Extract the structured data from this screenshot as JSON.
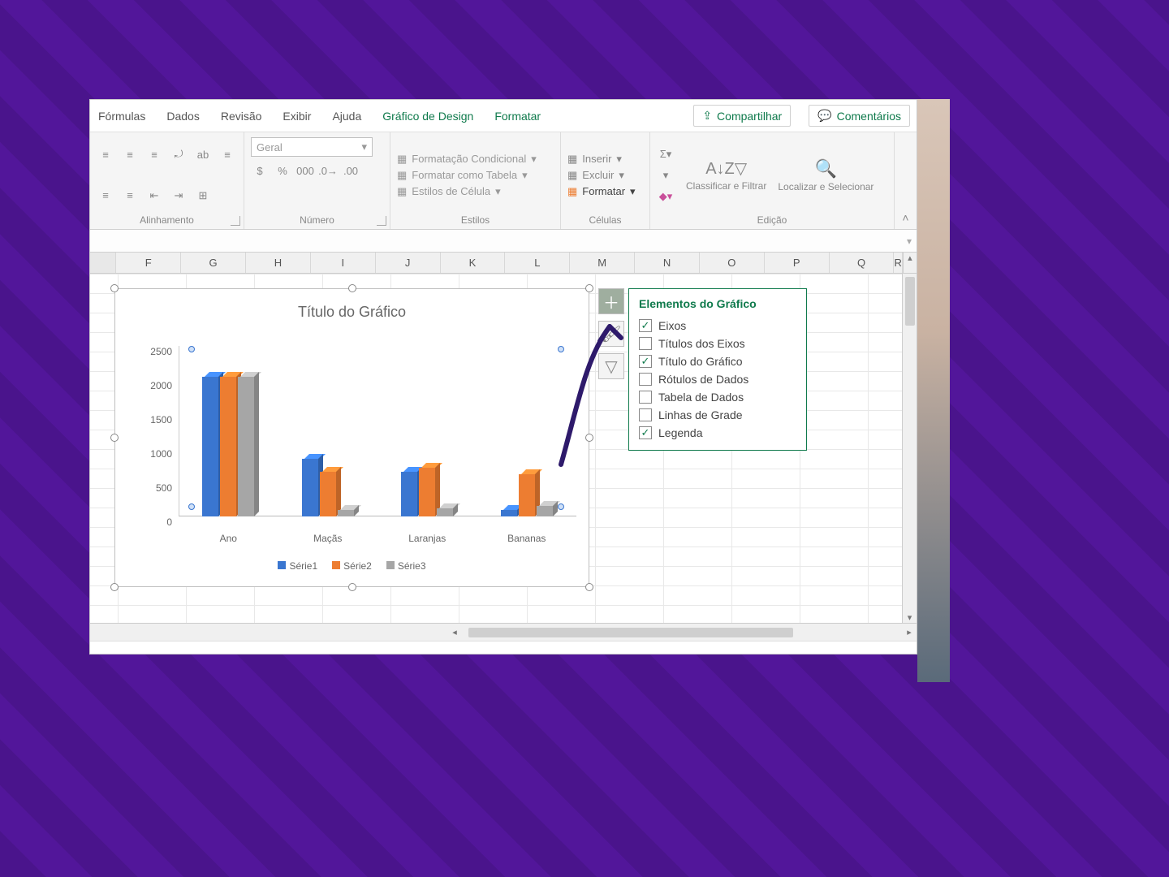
{
  "ribbon": {
    "tabs": [
      "Fórmulas",
      "Dados",
      "Revisão",
      "Exibir",
      "Ajuda"
    ],
    "context_tabs": [
      "Gráfico de Design",
      "Formatar"
    ],
    "share": "Compartilhar",
    "comments": "Comentários",
    "groups": {
      "alignment": "Alinhamento",
      "number": "Número",
      "number_format": "Geral",
      "styles": "Estilos",
      "cells": "Células",
      "editing": "Edição"
    },
    "styles_items": [
      "Formatação Condicional",
      "Formatar como Tabela",
      "Estilos de Célula"
    ],
    "cells_items": [
      "Inserir",
      "Excluir",
      "Formatar"
    ],
    "editing_items": {
      "sort": "Classificar e Filtrar",
      "find": "Localizar e Selecionar"
    }
  },
  "columns": [
    "F",
    "G",
    "H",
    "I",
    "J",
    "K",
    "L",
    "M",
    "N",
    "O",
    "P",
    "Q",
    "R"
  ],
  "chart": {
    "title": "Título do Gráfico",
    "legend": [
      "Série1",
      "Série2",
      "Série3"
    ]
  },
  "chart_elements_flyout": {
    "title": "Elementos do Gráfico",
    "options": [
      {
        "label": "Eixos",
        "checked": true
      },
      {
        "label": "Títulos dos Eixos",
        "checked": false
      },
      {
        "label": "Título do Gráfico",
        "checked": true
      },
      {
        "label": "Rótulos de Dados",
        "checked": false
      },
      {
        "label": "Tabela de Dados",
        "checked": false
      },
      {
        "label": "Linhas de Grade",
        "checked": false
      },
      {
        "label": "Legenda",
        "checked": true
      }
    ]
  },
  "chart_data": {
    "type": "bar",
    "title": "Título do Gráfico",
    "categories": [
      "Ano",
      "Maçãs",
      "Laranjas",
      "Bananas"
    ],
    "series": [
      {
        "name": "Série1",
        "color": "#3a76d0",
        "values": [
          2050,
          850,
          650,
          100
        ]
      },
      {
        "name": "Série2",
        "color": "#ed7d31",
        "values": [
          2050,
          650,
          720,
          620
        ]
      },
      {
        "name": "Série3",
        "color": "#a6a6a6",
        "values": [
          2050,
          100,
          120,
          150
        ]
      }
    ],
    "ylim": [
      0,
      2500
    ],
    "yticks": [
      0,
      500,
      1000,
      1500,
      2000,
      2500
    ],
    "xlabel": "",
    "ylabel": ""
  }
}
